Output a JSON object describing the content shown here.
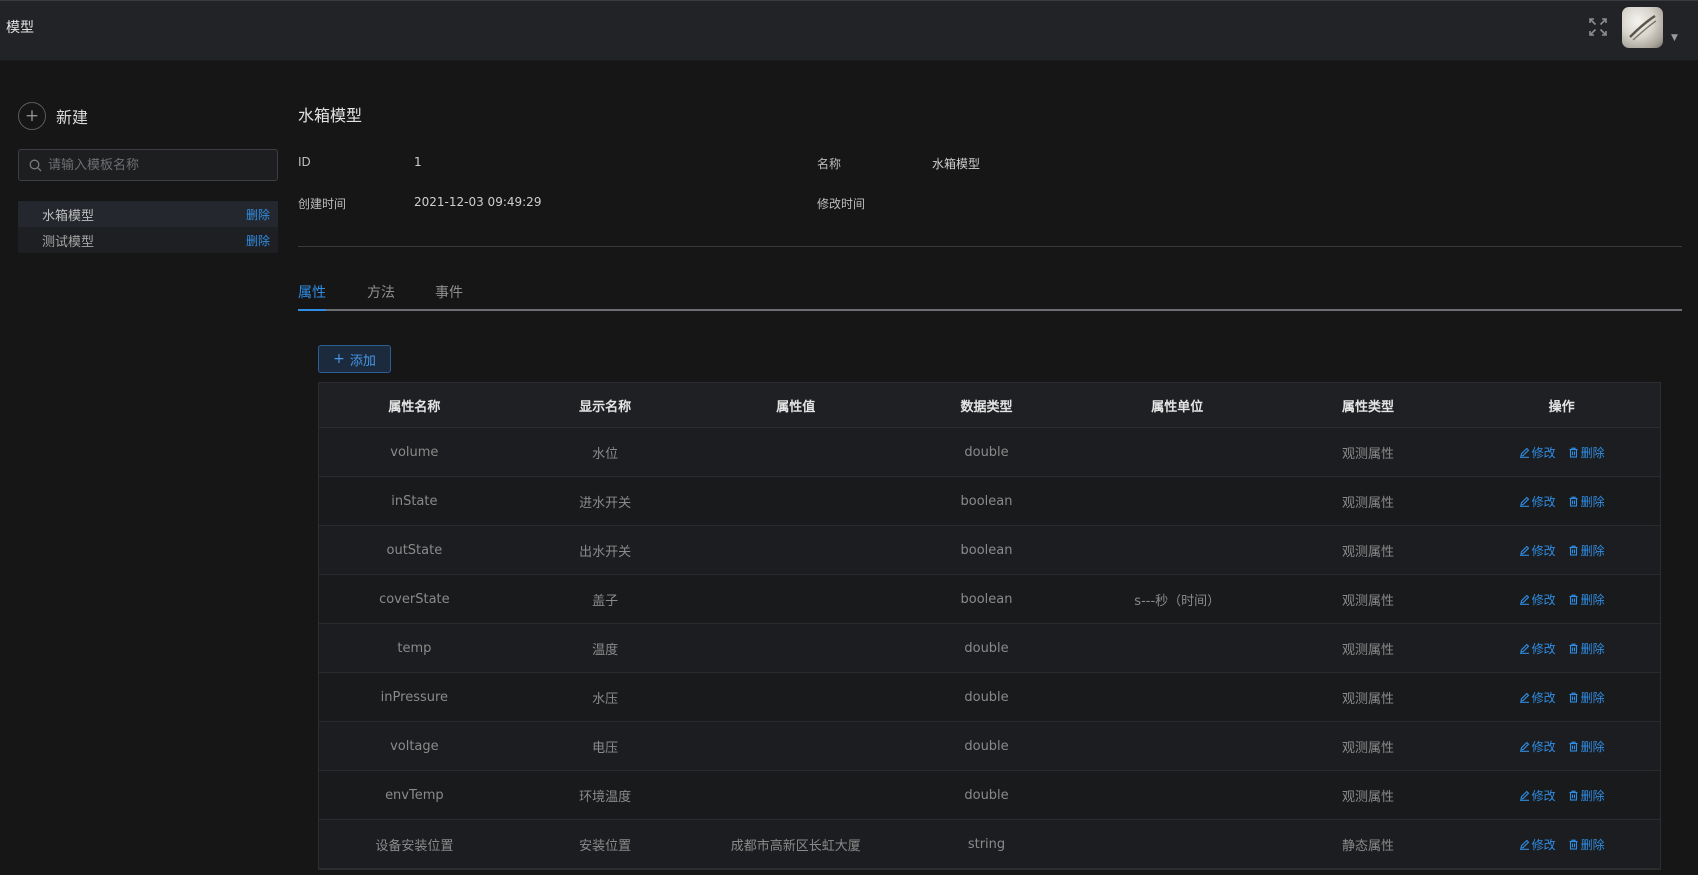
{
  "header": {
    "title": "模型",
    "fullscreen_icon": "fullscreen-icon",
    "avatar_icon": "user-avatar",
    "caret_icon": "caret-down-icon"
  },
  "sidebar": {
    "new_label": "新建",
    "search_placeholder": "请输入模板名称",
    "items": [
      {
        "label": "水箱模型",
        "delete_label": "删除"
      },
      {
        "label": "测试模型",
        "delete_label": "删除"
      }
    ]
  },
  "detail": {
    "title": "水箱模型",
    "id_label": "ID",
    "id_value": "1",
    "name_label": "名称",
    "name_value": "水箱模型",
    "created_label": "创建时间",
    "created_value": "2021-12-03 09:49:29",
    "modified_label": "修改时间",
    "modified_value": ""
  },
  "tabs": [
    {
      "label": "属性",
      "active": true
    },
    {
      "label": "方法",
      "active": false
    },
    {
      "label": "事件",
      "active": false
    }
  ],
  "add_button_label": "添加",
  "table": {
    "columns": [
      "属性名称",
      "显示名称",
      "属性值",
      "数据类型",
      "属性单位",
      "属性类型",
      "操作"
    ],
    "edit_label": "修改",
    "delete_label": "删除",
    "rows": [
      [
        "volume",
        "水位",
        "",
        "double",
        "",
        "观测属性"
      ],
      [
        "inState",
        "进水开关",
        "",
        "boolean",
        "",
        "观测属性"
      ],
      [
        "outState",
        "出水开关",
        "",
        "boolean",
        "",
        "观测属性"
      ],
      [
        "coverState",
        "盖子",
        "",
        "boolean",
        "s---秒（时间）",
        "观测属性"
      ],
      [
        "temp",
        "温度",
        "",
        "double",
        "",
        "观测属性"
      ],
      [
        "inPressure",
        "水压",
        "",
        "double",
        "",
        "观测属性"
      ],
      [
        "voltage",
        "电压",
        "",
        "double",
        "",
        "观测属性"
      ],
      [
        "envTemp",
        "环境温度",
        "",
        "double",
        "",
        "观测属性"
      ],
      [
        "设备安装位置",
        "安装位置",
        "成都市高新区长虹大厦",
        "string",
        "",
        "静态属性"
      ]
    ]
  },
  "colors": {
    "accent": "#2f8de4",
    "background": "#161617",
    "header": "#222327"
  }
}
